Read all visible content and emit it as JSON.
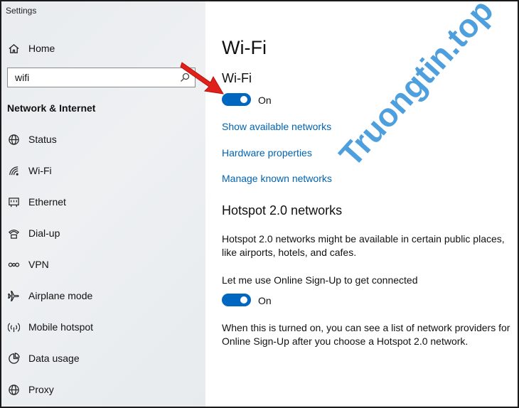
{
  "window": {
    "title": "Settings"
  },
  "sidebar": {
    "home_label": "Home",
    "search": {
      "value": "wifi",
      "icon": "search-icon"
    },
    "section_title": "Network & Internet",
    "items": [
      {
        "label": "Status",
        "icon": "globe-icon"
      },
      {
        "label": "Wi-Fi",
        "icon": "wifi-icon"
      },
      {
        "label": "Ethernet",
        "icon": "ethernet-icon"
      },
      {
        "label": "Dial-up",
        "icon": "dial-up-icon"
      },
      {
        "label": "VPN",
        "icon": "vpn-icon"
      },
      {
        "label": "Airplane mode",
        "icon": "airplane-icon"
      },
      {
        "label": "Mobile hotspot",
        "icon": "hotspot-icon"
      },
      {
        "label": "Data usage",
        "icon": "data-usage-icon"
      },
      {
        "label": "Proxy",
        "icon": "globe-icon"
      }
    ]
  },
  "main": {
    "title": "Wi-Fi",
    "wifi_section_title": "Wi-Fi",
    "wifi_toggle": {
      "state": "On",
      "on": true
    },
    "links": {
      "show_networks": "Show available networks",
      "hardware": "Hardware properties",
      "manage": "Manage known networks"
    },
    "hotspot": {
      "title": "Hotspot 2.0 networks",
      "description": "Hotspot 2.0 networks might be available in certain public places, like airports, hotels, and cafes.",
      "online_signup_label": "Let me use Online Sign-Up to get connected",
      "toggle": {
        "state": "On",
        "on": true
      },
      "note": "When this is turned on, you can see a list of network providers for Online Sign-Up after you choose a Hotspot 2.0 network."
    }
  },
  "watermark": {
    "text": "Truongtin.top"
  },
  "colors": {
    "accent": "#0067c0",
    "link": "#0063b1",
    "arrow": "#e0201b",
    "watermark": "#2f8ed8"
  }
}
